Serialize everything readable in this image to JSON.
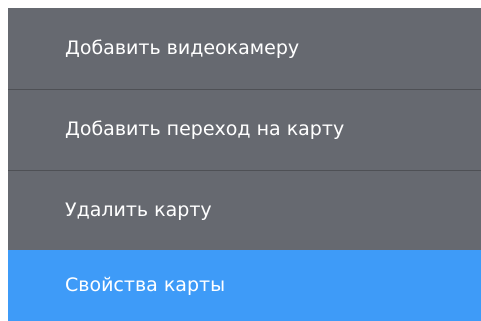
{
  "context_menu": {
    "items": [
      {
        "label": "Добавить видеокамеру",
        "selected": false
      },
      {
        "label": "Добавить переход на карту",
        "selected": false
      },
      {
        "label": "Удалить карту",
        "selected": false
      },
      {
        "label": "Свойства карты",
        "selected": true
      }
    ],
    "colors": {
      "background": "#666970",
      "divider": "#4e5055",
      "selected": "#3e9bf8",
      "text": "#ffffff"
    }
  }
}
